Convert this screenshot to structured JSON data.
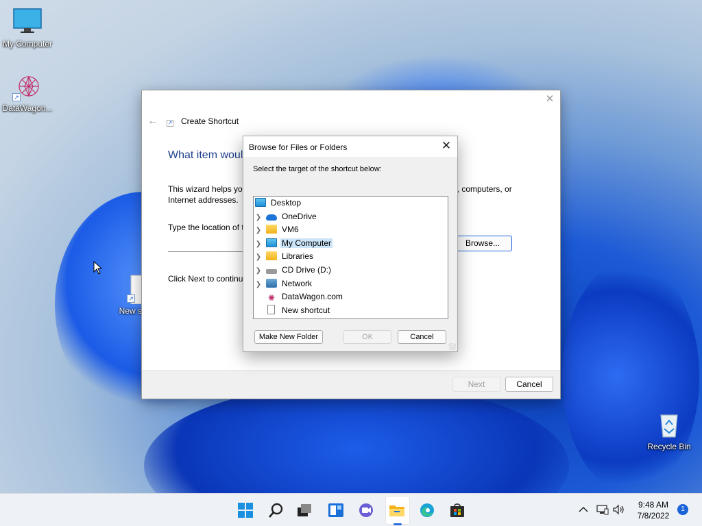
{
  "desktop": {
    "icons": [
      {
        "label": "My Computer",
        "icon": "monitor-icon"
      },
      {
        "label": "DataWagon...",
        "icon": "datawagon-icon"
      },
      {
        "label": "New sho",
        "icon": "blank-file-icon"
      },
      {
        "label": "Recycle Bin",
        "icon": "recycle-bin-icon"
      }
    ]
  },
  "wizard": {
    "title": "Create Shortcut",
    "heading": "What item woul",
    "description_start": "This wizard helps you",
    "description_end": "ers, computers, or",
    "description_line2": "Internet addresses.",
    "location_label": "Type the location of t",
    "location_value": "",
    "browse_label": "Browse...",
    "continue_text": "Click Next to continu",
    "next_label": "Next",
    "cancel_label": "Cancel"
  },
  "browse_dialog": {
    "title": "Browse for Files or Folders",
    "prompt": "Select the target of the shortcut below:",
    "tree": [
      {
        "label": "Desktop",
        "icon": "desktop-icon",
        "expandable": false,
        "level": 0,
        "selected": false
      },
      {
        "label": "OneDrive",
        "icon": "onedrive-cloud-icon",
        "expandable": true,
        "level": 1,
        "selected": false
      },
      {
        "label": "VM6",
        "icon": "folder-icon",
        "expandable": true,
        "level": 1,
        "selected": false
      },
      {
        "label": "My Computer",
        "icon": "monitor-icon",
        "expandable": true,
        "level": 1,
        "selected": true
      },
      {
        "label": "Libraries",
        "icon": "folder-icon",
        "expandable": true,
        "level": 1,
        "selected": false
      },
      {
        "label": "CD Drive (D:)",
        "icon": "drive-icon",
        "expandable": true,
        "level": 1,
        "selected": false
      },
      {
        "label": "Network",
        "icon": "network-icon",
        "expandable": true,
        "level": 1,
        "selected": false
      },
      {
        "label": "DataWagon.com",
        "icon": "datawagon-icon",
        "expandable": false,
        "level": 1,
        "selected": false
      },
      {
        "label": "New shortcut",
        "icon": "shortcut-file-icon",
        "expandable": false,
        "level": 1,
        "selected": false
      }
    ],
    "make_new_folder_label": "Make New Folder",
    "ok_label": "OK",
    "cancel_label": "Cancel"
  },
  "taskbar": {
    "apps": [
      "start-icon",
      "search-icon",
      "task-view-icon",
      "widgets-icon",
      "chat-icon",
      "file-explorer-icon",
      "edge-icon",
      "store-icon"
    ],
    "time": "9:48 AM",
    "date": "7/8/2022",
    "notification_count": "1"
  },
  "colors": {
    "accent": "#1b63d8",
    "selection": "#cce4f7",
    "heading": "#1e3f8c"
  }
}
